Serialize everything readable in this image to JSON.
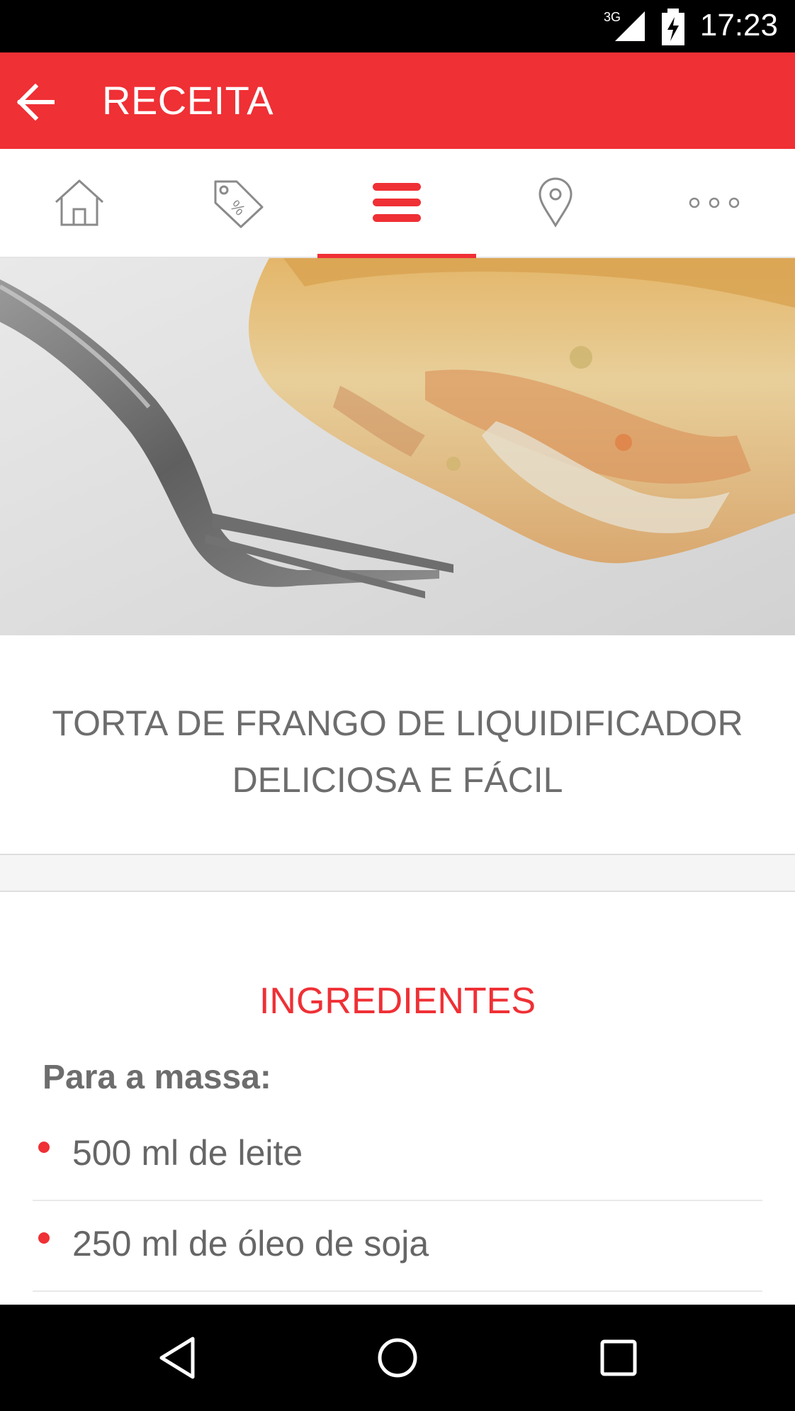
{
  "status_bar": {
    "network": "3G",
    "time": "17:23"
  },
  "app_bar": {
    "title": "RECEITA",
    "back_icon": "arrow-back-icon"
  },
  "tabs": [
    {
      "name": "home",
      "icon": "house-icon",
      "active": false
    },
    {
      "name": "offers",
      "icon": "price-tag-percent-icon",
      "active": false
    },
    {
      "name": "menu",
      "icon": "hamburger-menu-icon",
      "active": true
    },
    {
      "name": "location",
      "icon": "map-pin-icon",
      "active": false
    },
    {
      "name": "more",
      "icon": "more-dots-icon",
      "active": false
    }
  ],
  "recipe": {
    "title_line1": "TORTA DE FRANGO DE LIQUIDIFICADOR",
    "title_line2": "DELICIOSA E FÁCIL"
  },
  "ingredients": {
    "heading": "INGREDIENTES",
    "subheading": "Para a massa:",
    "items": [
      "500 ml de leite",
      "250 ml de óleo de soja"
    ]
  },
  "colors": {
    "accent": "#ef3035",
    "text": "#6d6d6d"
  }
}
